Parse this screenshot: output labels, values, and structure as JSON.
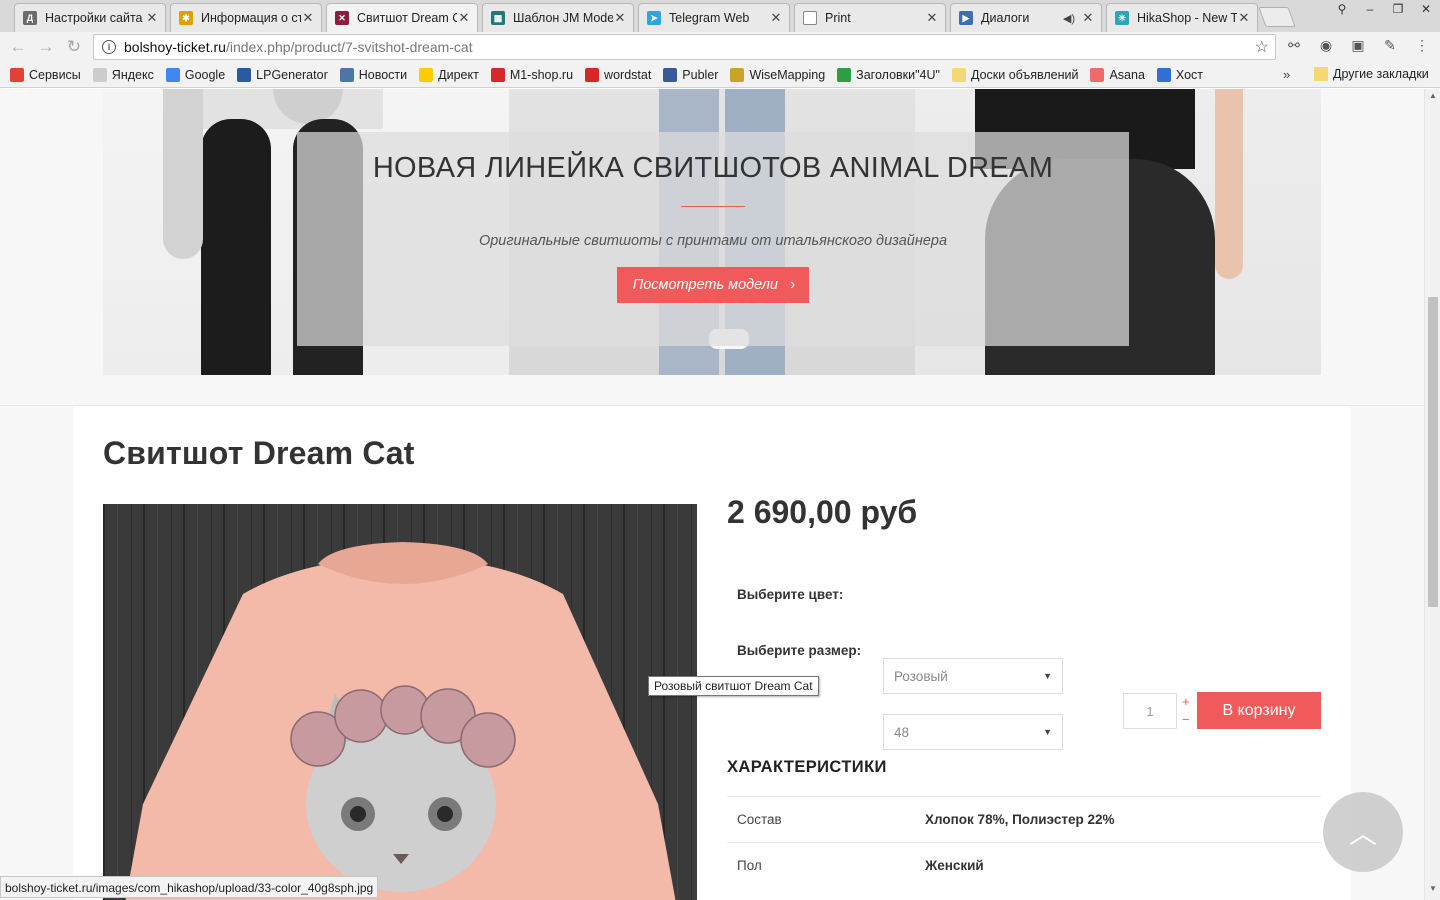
{
  "browser": {
    "tabs": [
      {
        "title": "Настройки сайта",
        "favicon_color": "#6b6b6b",
        "favicon_glyph": "Д",
        "active": false
      },
      {
        "title": "Информация о ст",
        "favicon_color": "#e0a000",
        "favicon_glyph": "✱",
        "active": false
      },
      {
        "title": "Свитшот Dream C",
        "favicon_color": "#8b1c3d",
        "favicon_glyph": "✕",
        "active": true
      },
      {
        "title": "Шаблон JM Mode",
        "favicon_color": "#1f7a7a",
        "favicon_glyph": "▦",
        "active": false
      },
      {
        "title": "Telegram Web",
        "favicon_color": "#2ca5e0",
        "favicon_glyph": "➤",
        "active": false
      },
      {
        "title": "Print",
        "favicon_color": "#ffffff",
        "favicon_glyph": "",
        "active": false
      },
      {
        "title": "Диалоги",
        "favicon_color": "#3c6fb0",
        "favicon_glyph": "▶",
        "active": false
      },
      {
        "title": "HikaShop - New T",
        "favicon_color": "#2aa6b5",
        "favicon_glyph": "✳",
        "active": false
      }
    ],
    "url_host": "bolshoy-ticket.ru",
    "url_path": "/index.php/product/7-svitshot-dream-cat",
    "bookmarks": [
      {
        "label": "Сервисы",
        "icon_color": "#e34133",
        "icon": "apps-icon"
      },
      {
        "label": "Яндекс",
        "icon_color": "#cccccc",
        "icon": "page-icon"
      },
      {
        "label": "Google",
        "icon_color": "#4285f4",
        "icon": "google-icon"
      },
      {
        "label": "LPGenerator",
        "icon_color": "#2b5aa0",
        "icon": "lp-icon"
      },
      {
        "label": "Новости",
        "icon_color": "#4a76a8",
        "icon": "vk-icon"
      },
      {
        "label": "Директ",
        "icon_color": "#ffcc00",
        "icon": "direct-icon"
      },
      {
        "label": "M1-shop.ru",
        "icon_color": "#d62828",
        "icon": "m1-icon"
      },
      {
        "label": "wordstat",
        "icon_color": "#d62828",
        "icon": "wordstat-icon"
      },
      {
        "label": "Publer",
        "icon_color": "#3b5998",
        "icon": "publer-icon"
      },
      {
        "label": "WiseMapping",
        "icon_color": "#c9a227",
        "icon": "wisemapping-icon"
      },
      {
        "label": "Заголовки\"4U\"",
        "icon_color": "#2e9e44",
        "icon": "dollar-icon"
      },
      {
        "label": "Доски объявлений",
        "icon_color": "#f5d774",
        "icon": "folder-icon"
      },
      {
        "label": "Asana",
        "icon_color": "#f06a6a",
        "icon": "asana-icon"
      },
      {
        "label": "Хост",
        "icon_color": "#2f6fd6",
        "icon": "check-icon"
      }
    ],
    "bookmarks_more": "»",
    "other_bookmarks": "Другие закладки",
    "status_url": "bolshoy-ticket.ru/images/com_hikashop/upload/33-color_40g8sph.jpg"
  },
  "banner": {
    "heading": "НОВАЯ ЛИНЕЙКА СВИТШОТОВ ANIMAL DREAM",
    "subtitle": "Оригинальные свитшоты с принтами от итальянского дизайнера",
    "cta_label": "Посмотреть модели",
    "cta_arrow": "›"
  },
  "product": {
    "title": "Свитшот Dream Cat",
    "price": "2 690,00 руб",
    "color_label": "Выберите цвет:",
    "color_value": "Розовый",
    "size_label": "Выберите размер:",
    "size_value": "48",
    "image_tooltip": "Розовый свитшот Dream Cat",
    "quantity": "1",
    "qty_plus": "+",
    "qty_minus": "−",
    "add_to_cart": "В корзину",
    "specs_title": "ХАРАКТЕРИСТИКИ",
    "specs": [
      {
        "key": "Состав",
        "value": "Хлопок 78%, Полиэстер 22%"
      },
      {
        "key": "Пол",
        "value": "Женский"
      }
    ]
  },
  "colors": {
    "accent": "#f15a5a",
    "sweater": "#f3b9a9"
  }
}
